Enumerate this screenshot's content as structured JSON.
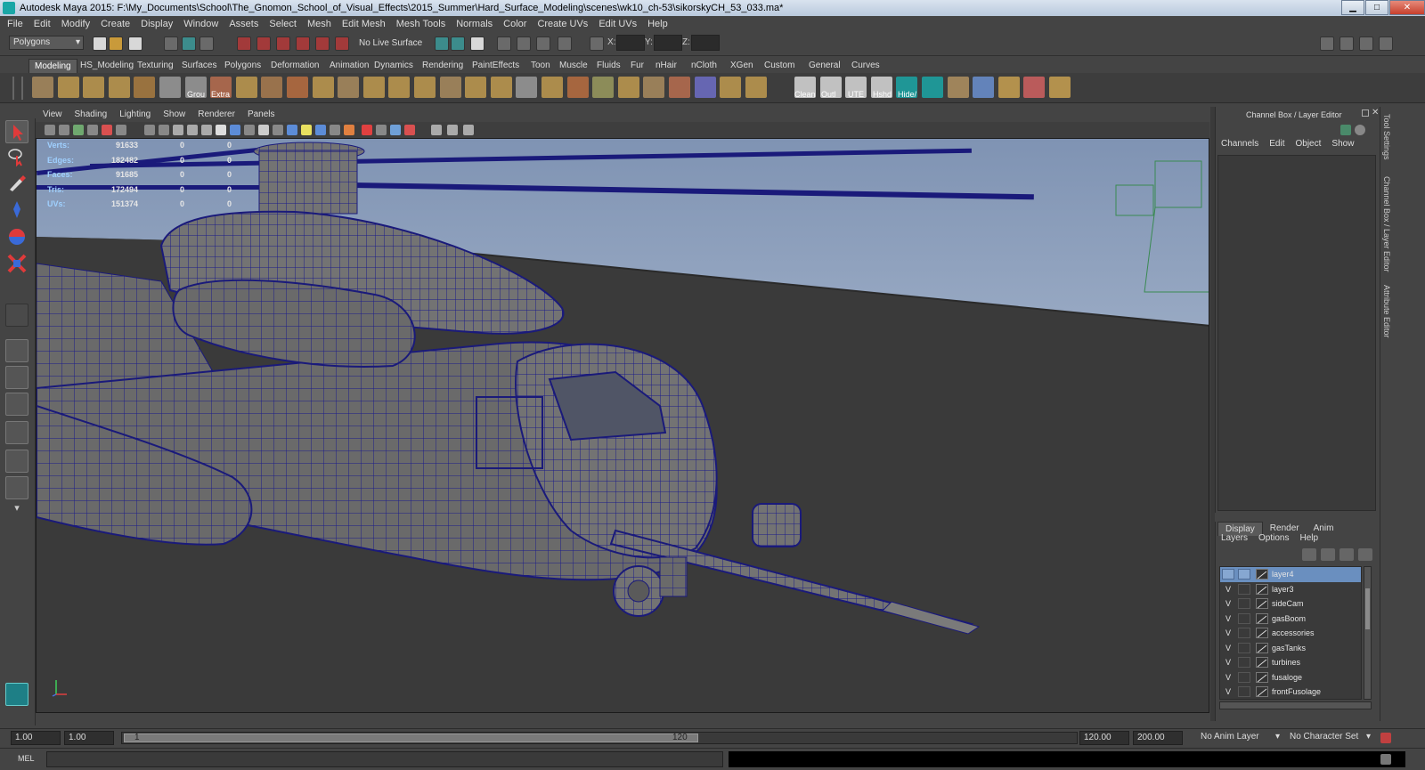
{
  "window": {
    "title": "Autodesk Maya 2015: F:\\My_Documents\\School\\The_Gnomon_School_of_Visual_Effects\\2015_Summer\\Hard_Surface_Modeling\\scenes\\wk10_ch-53\\sikorskyCH_53_033.ma*",
    "minimize": "▁",
    "maximize": "□",
    "close": "✕"
  },
  "menubar": [
    "File",
    "Edit",
    "Modify",
    "Create",
    "Display",
    "Window",
    "Assets",
    "Select",
    "Mesh",
    "Edit Mesh",
    "Mesh Tools",
    "Normals",
    "Color",
    "Create UVs",
    "Edit UVs",
    "Help"
  ],
  "statusline": {
    "mode": "Polygons",
    "live_surface": "No Live Surface",
    "x_label": "X:",
    "y_label": "Y:",
    "z_label": "Z:"
  },
  "shelf_tabs": [
    "Modeling",
    "HS_Modeling",
    "Texturing",
    "Surfaces",
    "Polygons",
    "Deformation",
    "Animation",
    "Dynamics",
    "Rendering",
    "PaintEffects",
    "Toon",
    "Muscle",
    "Fluids",
    "Fur",
    "nHair",
    "nCloth",
    "XGen",
    "Custom",
    "General",
    "Curves"
  ],
  "shelf_labels": [
    "Grou",
    "Extra",
    "Clean",
    "Outl",
    "UTE",
    "Hshd",
    "Hide/"
  ],
  "panel_menu": [
    "View",
    "Shading",
    "Lighting",
    "Show",
    "Renderer",
    "Panels"
  ],
  "hud": {
    "rows": [
      {
        "label": "Verts:",
        "v1": "91633",
        "v2": "0",
        "v3": "0"
      },
      {
        "label": "Edges:",
        "v1": "182482",
        "v2": "0",
        "v3": "0"
      },
      {
        "label": "Faces:",
        "v1": "91685",
        "v2": "0",
        "v3": "0"
      },
      {
        "label": "Tris:",
        "v1": "172494",
        "v2": "0",
        "v3": "0"
      },
      {
        "label": "UVs:",
        "v1": "151374",
        "v2": "0",
        "v3": "0"
      }
    ]
  },
  "channel_box": {
    "title": "Channel Box / Layer Editor",
    "menu": [
      "Channels",
      "Edit",
      "Object",
      "Show"
    ]
  },
  "side_tabs": [
    "Tool Settings",
    "Channel Box / Layer Editor",
    "Attribute Editor"
  ],
  "layer_editor": {
    "tabs": [
      "Display",
      "Render",
      "Anim"
    ],
    "menu": [
      "Layers",
      "Options",
      "Help"
    ],
    "layers": [
      {
        "name": "layer4",
        "visible": "",
        "selected": true
      },
      {
        "name": "layer3",
        "visible": "V",
        "selected": false
      },
      {
        "name": "sideCam",
        "visible": "V",
        "selected": false
      },
      {
        "name": "gasBoom",
        "visible": "V",
        "selected": false
      },
      {
        "name": "accessories",
        "visible": "V",
        "selected": false
      },
      {
        "name": "gasTanks",
        "visible": "V",
        "selected": false
      },
      {
        "name": "turbines",
        "visible": "V",
        "selected": false
      },
      {
        "name": "fusaloge",
        "visible": "V",
        "selected": false
      },
      {
        "name": "frontFusolage",
        "visible": "V",
        "selected": false
      }
    ]
  },
  "timeline": {
    "start": "1.00",
    "current": "1.00",
    "range_start": "1",
    "range_end": "120",
    "end": "120.00",
    "max": "200.00",
    "anim_layer": "No Anim Layer",
    "char_set": "No Character Set"
  },
  "command_line": {
    "mode": "MEL"
  },
  "colors": {
    "wire": "#1a1a8c",
    "mesh": "#6e6e6e",
    "sky": "#8aa0bf",
    "ground": "#3a3a3a",
    "accent_select": "#6a8fbf"
  }
}
